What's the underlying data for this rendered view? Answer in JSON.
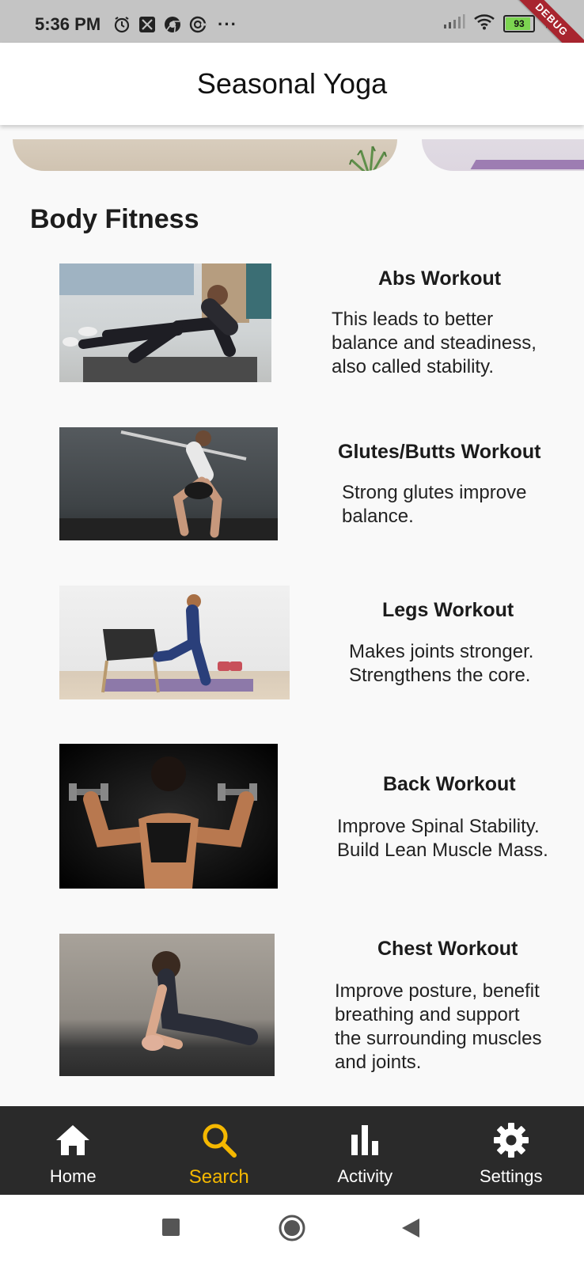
{
  "status_bar": {
    "time": "5:36 PM",
    "dots": "···",
    "battery_level": "93",
    "debug_label": "DEBUG",
    "icons": [
      "alarm-icon",
      "app-icon",
      "chrome-icon",
      "sync-icon",
      "signal-icon",
      "wifi-icon",
      "battery-icon",
      "charging-icon"
    ]
  },
  "app_bar": {
    "title": "Seasonal Yoga"
  },
  "section": {
    "title": "Body Fitness"
  },
  "workouts": [
    {
      "title": "Abs Workout",
      "description": "This leads to better\nbalance and steadiness,\n also called stability."
    },
    {
      "title": "Glutes/Butts Workout",
      "description": "Strong glutes improve\n  balance."
    },
    {
      "title": "Legs Workout",
      "description": "Makes joints stronger.\nStrengthens the core."
    },
    {
      "title": "Back Workout",
      "description": "Improve Spinal Stability.\nBuild Lean Muscle Mass."
    },
    {
      "title": "Chest Workout",
      "description": "Improve posture, benefit\nbreathing and support\nthe surrounding muscles\nand joints."
    }
  ],
  "bottom_nav": {
    "items": [
      {
        "label": "Home",
        "icon": "home-icon",
        "active": false
      },
      {
        "label": "Search",
        "icon": "search-icon",
        "active": true
      },
      {
        "label": "Activity",
        "icon": "bar-chart-icon",
        "active": false
      },
      {
        "label": "Settings",
        "icon": "gear-icon",
        "active": false
      }
    ],
    "active_color": "#f5b800",
    "background": "#2a2a2a"
  },
  "system_nav": {
    "icons": [
      "recents-icon",
      "home-circle-icon",
      "back-icon"
    ]
  }
}
